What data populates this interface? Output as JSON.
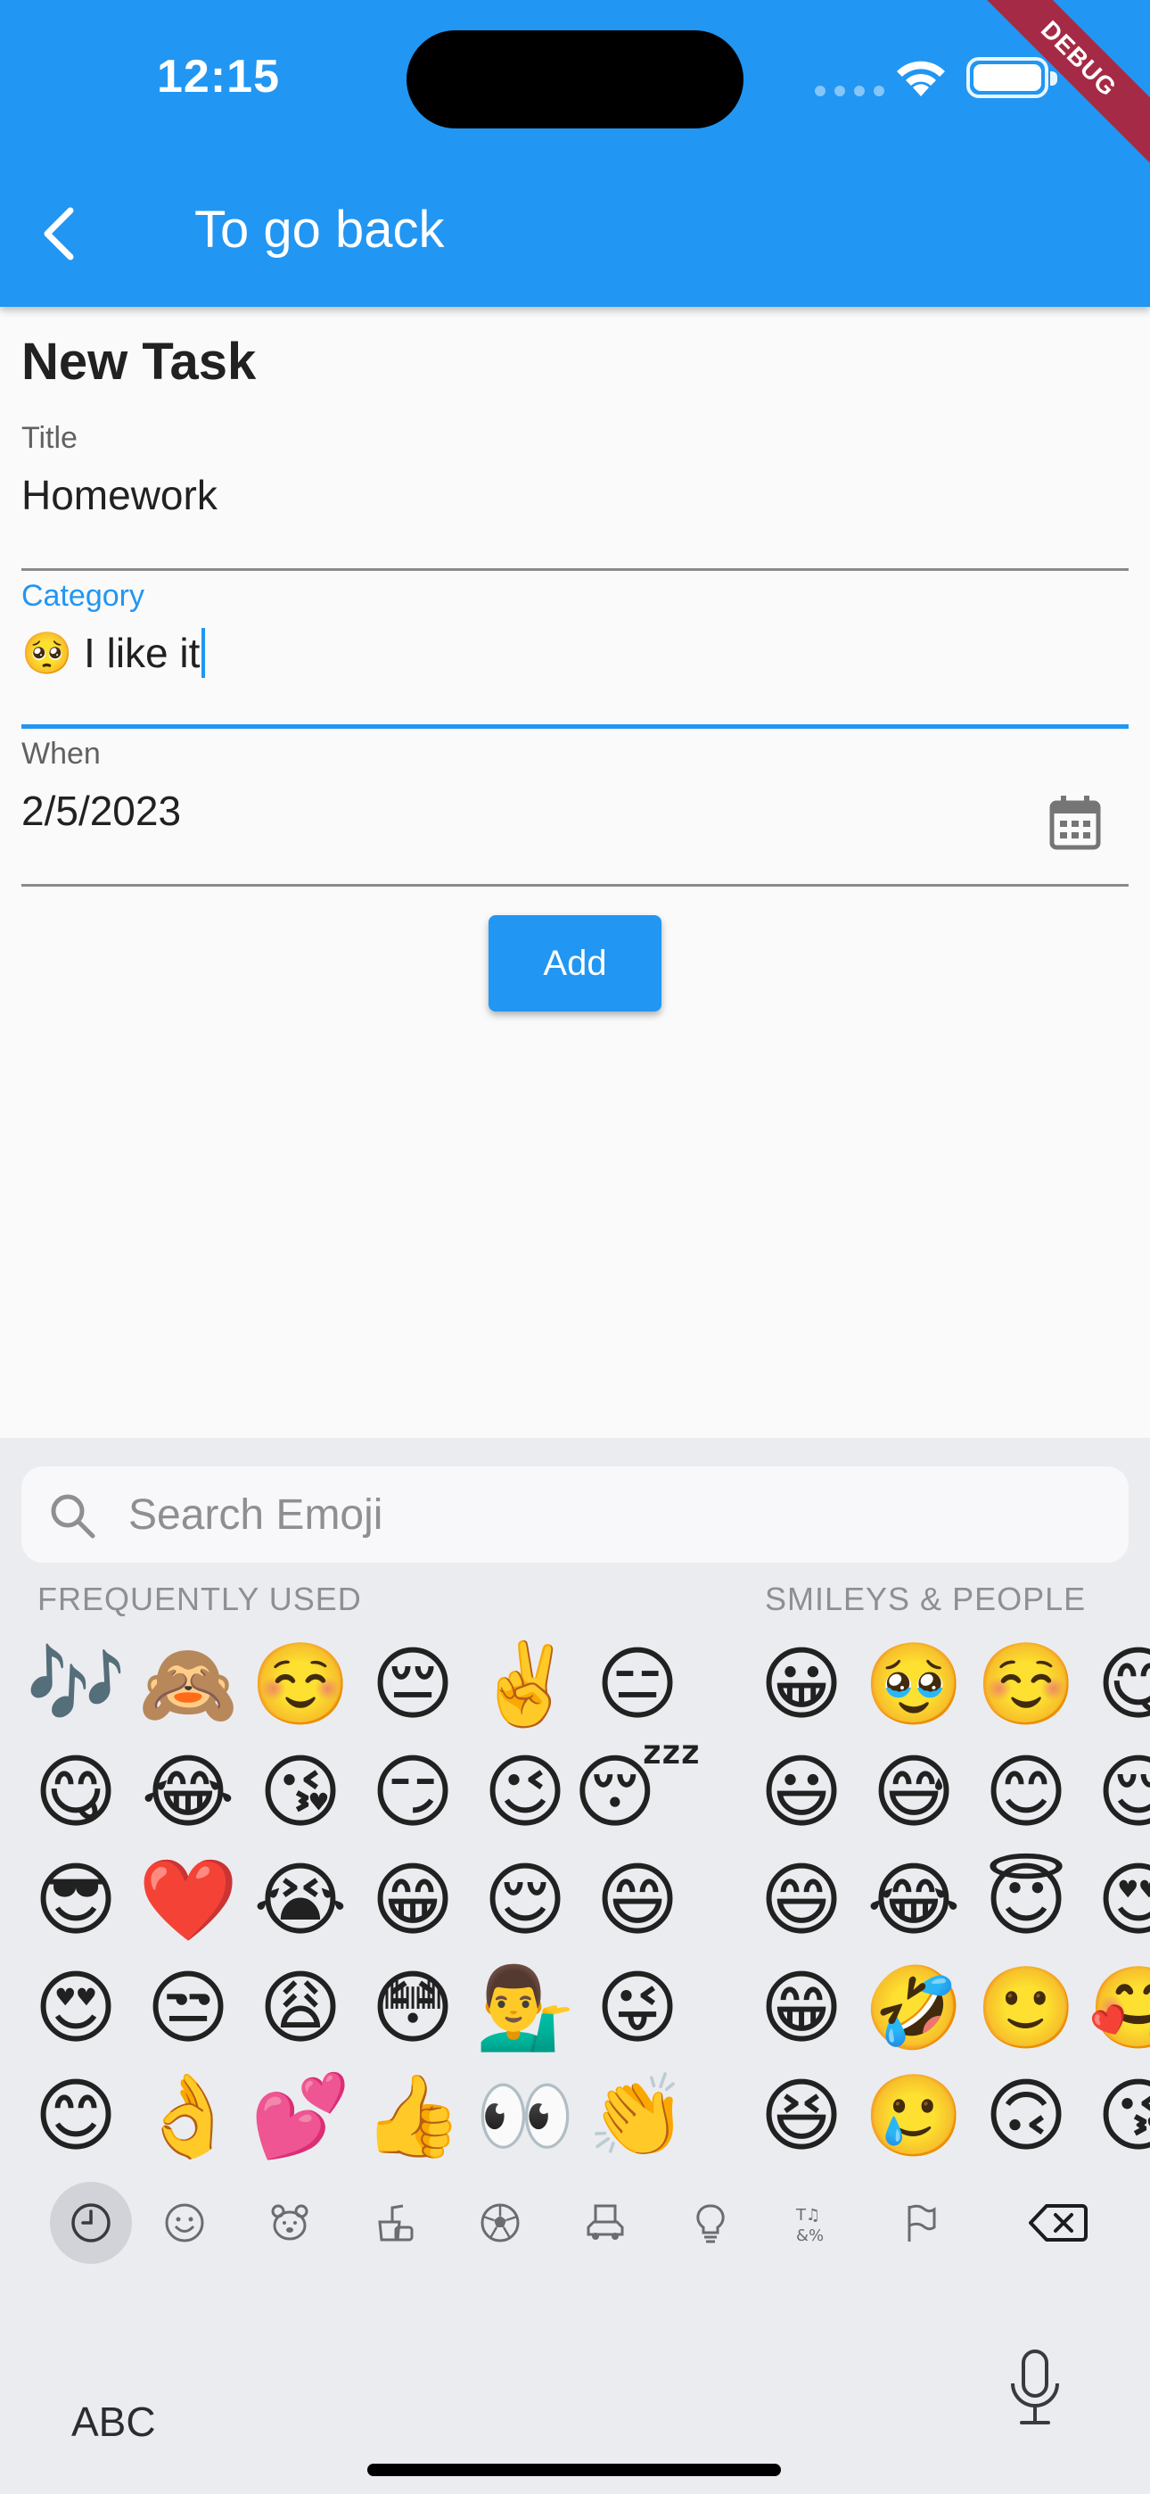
{
  "status_bar": {
    "time": "12:15",
    "debug_banner": "DEBUG"
  },
  "app_bar": {
    "title": "To go back",
    "back_icon": "chevron-left-icon"
  },
  "form": {
    "heading": "New Task",
    "title_field": {
      "label": "Title",
      "value": "Homework"
    },
    "category_field": {
      "label": "Category",
      "value": "🥺 I like it"
    },
    "when_field": {
      "label": "When",
      "value": "2/5/2023",
      "icon": "calendar-icon"
    },
    "add_button": "Add"
  },
  "keyboard": {
    "search_placeholder": "Search Emoji",
    "frequently_used_label": "FREQUENTLY USED",
    "smileys_label": "SMILEYS & PEOPLE",
    "frequently_used": [
      "🎶",
      "🙈",
      "☺️",
      "😔",
      "✌️",
      "😑",
      "😋",
      "😂",
      "😘",
      "😏",
      "😉",
      "😴",
      "😎",
      "❤️",
      "😭",
      "😁",
      "😌",
      "😄",
      "😍",
      "😒",
      "😩",
      "😳",
      "💁‍♂️",
      "😜",
      "😊",
      "👌",
      "💕",
      "👍",
      "👀",
      "👏"
    ],
    "smileys": [
      "😀",
      "🥹",
      "☺️",
      "😋",
      "😃",
      "😅",
      "😊",
      "😌",
      "😄",
      "😂",
      "😇",
      "😍",
      "😁",
      "🤣",
      "🙂",
      "🥰",
      "😆",
      "🥲",
      "🙃",
      "😘"
    ],
    "categories": [
      "recent-icon",
      "smiley-icon",
      "animal-icon",
      "food-icon",
      "ball-icon",
      "travel-icon",
      "lightbulb-icon",
      "symbols-icon",
      "flag-icon"
    ],
    "abc_label": "ABC",
    "accent": "#2196f3"
  }
}
